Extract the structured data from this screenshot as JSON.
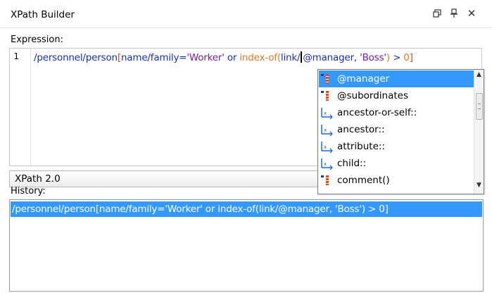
{
  "window": {
    "title": "XPath Builder",
    "icons": [
      "restore-icon",
      "pin-icon",
      "close-icon"
    ],
    "close_glyph": "✕"
  },
  "expression": {
    "label": "Expression:",
    "line_number": "1",
    "tokens": {
      "path": "/personnel/person",
      "open_bracket": "[",
      "pred_path": "name/family",
      "eq": "=",
      "string1": "'Worker'",
      "or": " or ",
      "func": "index-of(",
      "arg_path_before": "link/",
      "arg_attr": "@manager",
      "comma": ", ",
      "string2": "'Boss'",
      "close_paren": ")",
      "gt": " > ",
      "num": "0",
      "close_bracket": "]"
    }
  },
  "autocomplete": {
    "items": [
      {
        "label": "@manager",
        "icon": "attribute-icon",
        "selected": true
      },
      {
        "label": "@subordinates",
        "icon": "attribute-icon",
        "selected": false
      },
      {
        "label": "ancestor-or-self::",
        "icon": "axis-icon",
        "selected": false
      },
      {
        "label": "ancestor::",
        "icon": "axis-icon",
        "selected": false
      },
      {
        "label": "attribute::",
        "icon": "axis-icon",
        "selected": false
      },
      {
        "label": "child::",
        "icon": "axis-icon",
        "selected": false
      },
      {
        "label": "comment()",
        "icon": "attribute-icon",
        "selected": false
      }
    ]
  },
  "version": {
    "selected": "XPath 2.0"
  },
  "history": {
    "label": "History:",
    "entries": [
      "/personnel/person[name/family='Worker' or index-of(link/@manager, 'Boss') > 0]"
    ]
  },
  "colors": {
    "selection": "#3399ff",
    "path": "#1a2db0",
    "bracket": "#e0491a",
    "string": "#7a1aa0",
    "function": "#e07a1a"
  }
}
